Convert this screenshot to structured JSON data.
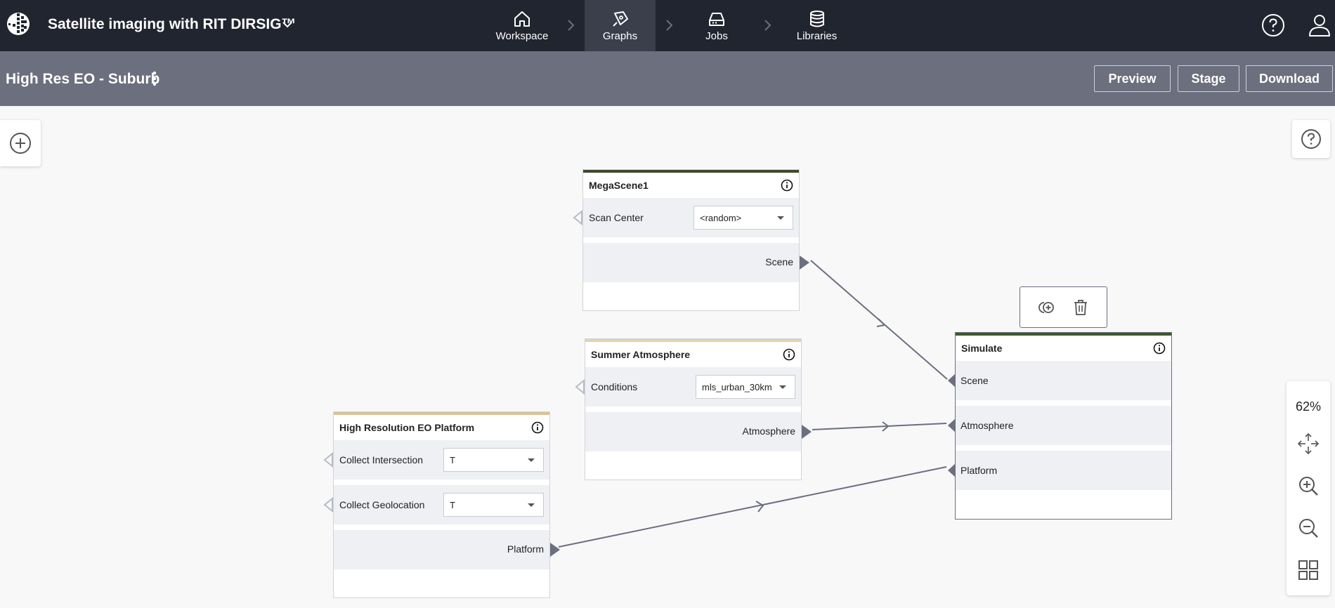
{
  "app": {
    "title": "Satellite imaging with RIT DIRSIG™"
  },
  "nav": [
    {
      "label": "Workspace",
      "icon": "home-icon",
      "active": false
    },
    {
      "label": "Graphs",
      "icon": "pen-nib-icon",
      "active": true
    },
    {
      "label": "Jobs",
      "icon": "hard-drive-icon",
      "active": false
    },
    {
      "label": "Libraries",
      "icon": "database-icon",
      "active": false
    }
  ],
  "subheader": {
    "graph_title": "High Res EO - Suburb",
    "preview_label": "Preview",
    "stage_label": "Stage",
    "download_label": "Download"
  },
  "nodes": {
    "megascene": {
      "title": "MegaScene1",
      "accent": "#3d4a2c",
      "inputs": [
        {
          "label": "Scan Center",
          "value": "<random>"
        }
      ],
      "output": "Scene"
    },
    "atmosphere": {
      "title": "Summer Atmosphere",
      "accent": "#e2d4b0",
      "inputs": [
        {
          "label": "Conditions",
          "value": "mls_urban_30km"
        }
      ],
      "output": "Atmosphere"
    },
    "platform": {
      "title": "High Resolution EO Platform",
      "accent": "#d8c49a",
      "inputs": [
        {
          "label": "Collect Intersection",
          "value": "T"
        },
        {
          "label": "Collect Geolocation",
          "value": "T"
        }
      ],
      "output": "Platform"
    },
    "simulate": {
      "title": "Simulate",
      "accent": "#3b5a2a",
      "inputs": [
        "Scene",
        "Atmosphere",
        "Platform"
      ]
    }
  },
  "zoom": {
    "level": "62%"
  },
  "colors": {
    "topbar": "#21252f",
    "subbar": "#6b6f7e",
    "wire": "#6b6f7e",
    "canvas": "#f8f8f9"
  }
}
